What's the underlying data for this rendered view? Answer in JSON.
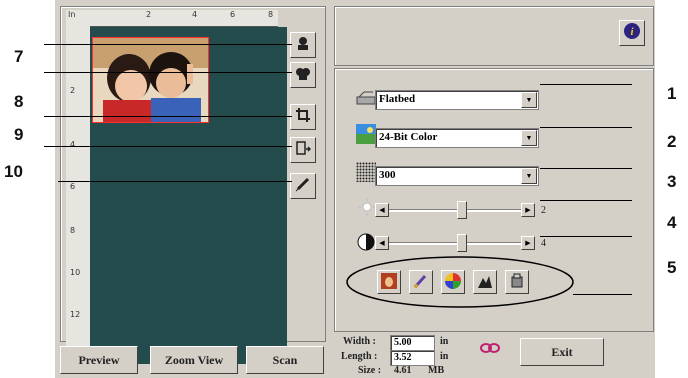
{
  "callouts": {
    "left": [
      "7",
      "8",
      "9",
      "10"
    ],
    "right": [
      "1",
      "2",
      "3",
      "4",
      "5"
    ]
  },
  "ruler": {
    "top_ticks": [
      "In",
      "2",
      "4",
      "6",
      "8"
    ],
    "left_ticks": [
      "2",
      "4",
      "6",
      "8",
      "10",
      "12"
    ]
  },
  "tools": {
    "icons": [
      "auto-preview-icon",
      "magnifier-icon",
      "crop-icon",
      "multi-crop-icon",
      "pen-icon"
    ]
  },
  "bottom_buttons": {
    "preview": "Preview",
    "zoom": "Zoom View",
    "scan": "Scan"
  },
  "settings": {
    "source": "Flatbed",
    "color_mode": "24-Bit Color",
    "resolution": "300",
    "brightness_value": "2",
    "contrast_value": "4"
  },
  "function_buttons": [
    "face-icon",
    "brush-icon",
    "color-wheel-icon",
    "levels-icon",
    "filter-icon"
  ],
  "dimensions": {
    "width_label": "Width :",
    "width_value": "5.00",
    "width_unit": "in",
    "length_label": "Length :",
    "length_value": "3.52",
    "length_unit": "in",
    "size_label": "Size :",
    "size_value": "4.61",
    "size_unit": "MB"
  },
  "exit_label": "Exit",
  "colors": {
    "preview_bg": "#244c4c",
    "crop_border": "#ff3030",
    "window_bg": "#d4d0c8"
  }
}
